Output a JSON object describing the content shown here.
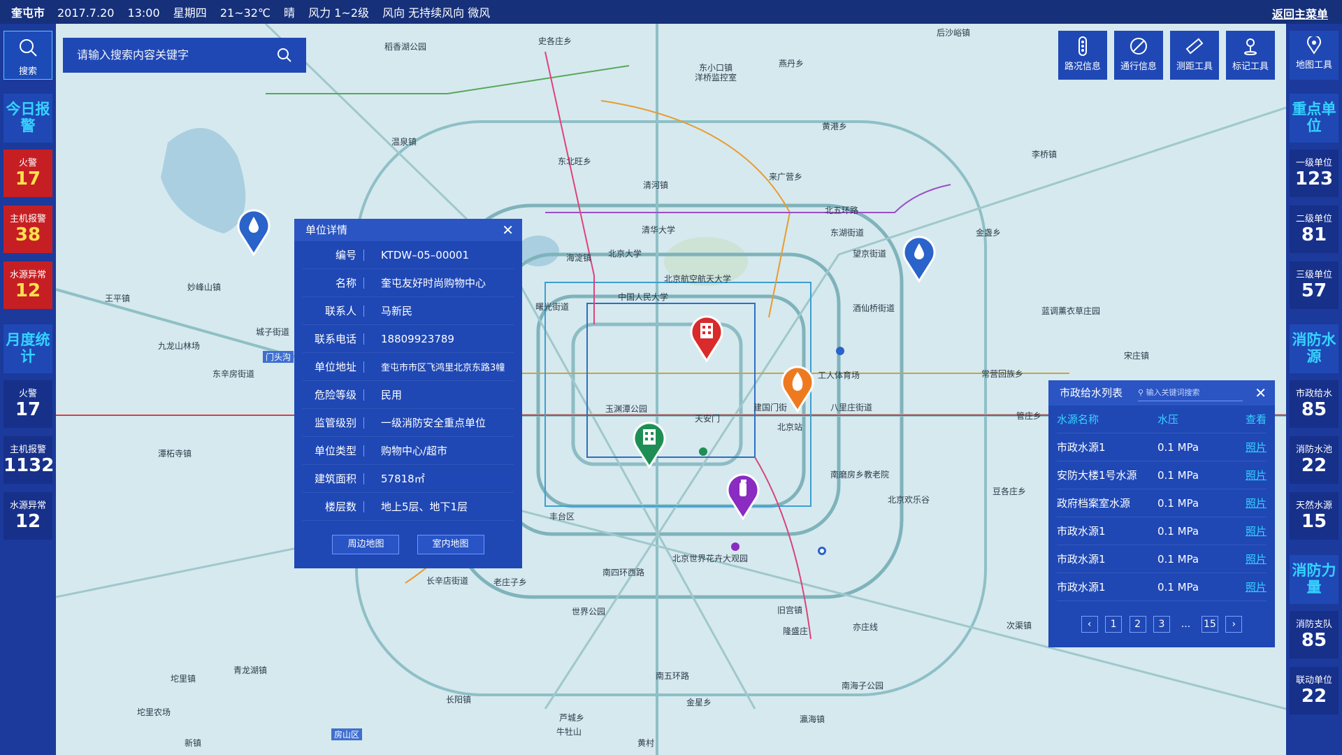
{
  "topbar": {
    "city": "奎屯市",
    "date": "2017.7.20",
    "time": "13:00",
    "weekday": "星期四",
    "temp": "21~32℃",
    "weather": "晴",
    "wind": "风力 1~2级",
    "direction": "风向 无持续风向 微风",
    "back": "返回主菜单"
  },
  "search": {
    "label": "搜索",
    "placeholder": "请输入搜索内容关键字"
  },
  "left": {
    "today_head": "今日报警",
    "today": [
      {
        "label": "火警",
        "value": "17"
      },
      {
        "label": "主机报警",
        "value": "38"
      },
      {
        "label": "水源异常",
        "value": "12"
      }
    ],
    "month_head": "月度统计",
    "month": [
      {
        "label": "火警",
        "value": "17"
      },
      {
        "label": "主机报警",
        "value": "1132"
      },
      {
        "label": "水源异常",
        "value": "12"
      }
    ]
  },
  "tools": {
    "road": "路况信息",
    "traffic": "通行信息",
    "measure": "测距工具",
    "mark": "标记工具"
  },
  "right": {
    "maptool": "地图工具",
    "key_head": "重点单位",
    "key": [
      {
        "label": "一级单位",
        "value": "123"
      },
      {
        "label": "二级单位",
        "value": "81"
      },
      {
        "label": "三级单位",
        "value": "57"
      }
    ],
    "water_head": "消防水源",
    "water": [
      {
        "label": "市政给水",
        "value": "85"
      },
      {
        "label": "消防水池",
        "value": "22"
      },
      {
        "label": "天然水源",
        "value": "15"
      }
    ],
    "force_head": "消防力量",
    "force": [
      {
        "label": "消防支队",
        "value": "85"
      },
      {
        "label": "联动单位",
        "value": "22"
      }
    ]
  },
  "detail": {
    "title": "单位详情",
    "rows": [
      {
        "k": "编号",
        "v": "KTDW–05–00001"
      },
      {
        "k": "名称",
        "v": "奎屯友好时尚购物中心"
      },
      {
        "k": "联系人",
        "v": "马新民"
      },
      {
        "k": "联系电话",
        "v": "18809923789"
      },
      {
        "k": "单位地址",
        "v": "奎屯市市区飞鸿里北京东路3幢"
      },
      {
        "k": "危险等级",
        "v": "民用"
      },
      {
        "k": "监管级别",
        "v": "一级消防安全重点单位"
      },
      {
        "k": "单位类型",
        "v": "购物中心/超市"
      },
      {
        "k": "建筑面积",
        "v": "57818㎡"
      },
      {
        "k": "楼层数",
        "v": "地上5层、地下1层"
      }
    ],
    "btn_around": "周边地图",
    "btn_indoor": "室内地图"
  },
  "water_list": {
    "title": "市政给水列表",
    "search_placeholder": "输入关键词搜索",
    "headers": {
      "name": "水源名称",
      "pressure": "水压",
      "view": "查看"
    },
    "rows": [
      {
        "name": "市政水源1",
        "pressure": "0.1 MPa",
        "view": "照片"
      },
      {
        "name": "安防大楼1号水源",
        "pressure": "0.1 MPa",
        "view": "照片"
      },
      {
        "name": "政府档案室水源",
        "pressure": "0.1 MPa",
        "view": "照片"
      },
      {
        "name": "市政水源1",
        "pressure": "0.1 MPa",
        "view": "照片"
      },
      {
        "name": "市政水源1",
        "pressure": "0.1 MPa",
        "view": "照片"
      },
      {
        "name": "市政水源1",
        "pressure": "0.1 MPa",
        "view": "照片"
      }
    ],
    "pages": [
      "1",
      "2",
      "3",
      "...",
      "15"
    ]
  },
  "map_labels": {
    "l1": "稻香湖公园",
    "l2": "史各庄乡",
    "l3": "东小口镇",
    "l4": "洋桥监控室",
    "l5": "燕丹乡",
    "l6": "后沙峪镇",
    "l7": "温泉镇",
    "l8": "东北旺乡",
    "l9": "清河镇",
    "l10": "北五环路",
    "l11": "来广营乡",
    "l12": "黄港乡",
    "l13": "李桥镇",
    "l14": "清华大学",
    "l15": "北京大学",
    "l16": "海淀镇",
    "l17": "北京航空航天大学",
    "l18": "中国人民大学",
    "l19": "曙光街道",
    "l20": "东湖街道",
    "l21": "望京街道",
    "l22": "金盏乡",
    "l23": "妙峰山镇",
    "l24": "王平镇",
    "l25": "九龙山林场",
    "l26": "城子街道",
    "l27": "东辛房街道",
    "l28": "酒仙桥街道",
    "l29": "蓝调薰衣草庄园",
    "l30": "工人体育场",
    "l31": "常营回族乡",
    "l32": "宋庄镇",
    "l33": "玉渊潭公园",
    "l34": "天安门",
    "l35": "建国门街",
    "l36": "北京站",
    "l37": "八里庄街道",
    "l38": "管庄乡",
    "l39": "潭柘寺镇",
    "l40": "南磨房乡教老院",
    "l41": "北京欢乐谷",
    "l42": "豆各庄乡",
    "l43": "丰台区",
    "l44": "长辛店街道",
    "l45": "老庄子乡",
    "l46": "南四环西路",
    "l47": "北京世界花卉大观园",
    "l48": "世界公园",
    "l49": "旧宫镇",
    "l50": "亦庄线",
    "l51": "次渠镇",
    "l52": "青龙湖镇",
    "l53": "坨里镇",
    "l54": "长阳镇",
    "l55": "南五环路",
    "l56": "金星乡",
    "l57": "南海子公园",
    "l58": "坨里农场",
    "l59": "新镇",
    "l60": "芦城乡",
    "l61": "牛牡山",
    "l62": "瀛海镇",
    "l63": "黄村",
    "l64": "房山区",
    "l65": "隆盛庄",
    "l66": "门头沟"
  }
}
